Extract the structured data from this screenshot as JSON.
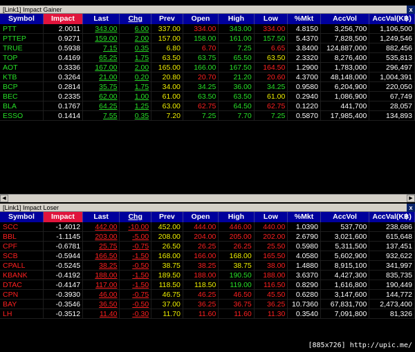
{
  "gainer": {
    "title": "[Link1] Impact Gainer",
    "close": "x",
    "headers": [
      "Symbol",
      "Impact",
      "Last",
      "Chg",
      "Prev",
      "Open",
      "High",
      "Low",
      "%Mkt",
      "AccVol",
      "AccVal(K฿)"
    ],
    "rows": [
      {
        "symbol": "PTT",
        "impact": "2.0011",
        "last": "343.00",
        "chg": "6.00",
        "prev": "337.00",
        "open": "334.00",
        "high": "343.00",
        "low": "334.00",
        "mkt": "4.8150",
        "vol": "3,256,700",
        "val": "1,106,500",
        "oc": "red",
        "hc": "green",
        "lc": "red"
      },
      {
        "symbol": "PTTEP",
        "impact": "0.9271",
        "last": "159.00",
        "chg": "2.00",
        "prev": "157.00",
        "open": "158.00",
        "high": "161.00",
        "low": "157.50",
        "mkt": "5.4370",
        "vol": "7,828,500",
        "val": "1,249,546",
        "oc": "green",
        "hc": "green",
        "lc": "green"
      },
      {
        "symbol": "TRUE",
        "impact": "0.5938",
        "last": "7.15",
        "chg": "0.35",
        "prev": "6.80",
        "open": "6.70",
        "high": "7.25",
        "low": "6.65",
        "mkt": "3.8400",
        "vol": "124,887,000",
        "val": "882,456",
        "oc": "red",
        "hc": "green",
        "lc": "red"
      },
      {
        "symbol": "TOP",
        "impact": "0.4169",
        "last": "65.25",
        "chg": "1.75",
        "prev": "63.50",
        "open": "63.75",
        "high": "65.50",
        "low": "63.50",
        "mkt": "2.3320",
        "vol": "8,276,400",
        "val": "535,813",
        "oc": "green",
        "hc": "green",
        "lc": "yellow"
      },
      {
        "symbol": "AOT",
        "impact": "0.3336",
        "last": "167.00",
        "chg": "2.00",
        "prev": "165.00",
        "open": "166.00",
        "high": "167.50",
        "low": "164.50",
        "mkt": "1.2900",
        "vol": "1,783,000",
        "val": "296,497",
        "oc": "green",
        "hc": "green",
        "lc": "red"
      },
      {
        "symbol": "KTB",
        "impact": "0.3264",
        "last": "21.00",
        "chg": "0.20",
        "prev": "20.80",
        "open": "20.70",
        "high": "21.20",
        "low": "20.60",
        "mkt": "4.3700",
        "vol": "48,148,000",
        "val": "1,004,391",
        "oc": "red",
        "hc": "green",
        "lc": "red"
      },
      {
        "symbol": "BCP",
        "impact": "0.2814",
        "last": "35.75",
        "chg": "1.75",
        "prev": "34.00",
        "open": "34.25",
        "high": "36.00",
        "low": "34.25",
        "mkt": "0.9580",
        "vol": "6,204,900",
        "val": "220,050",
        "oc": "green",
        "hc": "green",
        "lc": "green"
      },
      {
        "symbol": "BEC",
        "impact": "0.2335",
        "last": "62.00",
        "chg": "1.00",
        "prev": "61.00",
        "open": "63.50",
        "high": "63.50",
        "low": "61.00",
        "mkt": "0.2940",
        "vol": "1,086,900",
        "val": "67,749",
        "oc": "green",
        "hc": "green",
        "lc": "yellow"
      },
      {
        "symbol": "BLA",
        "impact": "0.1767",
        "last": "64.25",
        "chg": "1.25",
        "prev": "63.00",
        "open": "62.75",
        "high": "64.50",
        "low": "62.75",
        "mkt": "0.1220",
        "vol": "441,700",
        "val": "28,057",
        "oc": "red",
        "hc": "green",
        "lc": "red"
      },
      {
        "symbol": "ESSO",
        "impact": "0.1414",
        "last": "7.55",
        "chg": "0.35",
        "prev": "7.20",
        "open": "7.25",
        "high": "7.70",
        "low": "7.25",
        "mkt": "0.5870",
        "vol": "17,985,400",
        "val": "134,893",
        "oc": "green",
        "hc": "green",
        "lc": "green"
      }
    ]
  },
  "loser": {
    "title": "[Link1] Impact Loser",
    "close": "x",
    "headers": [
      "Symbol",
      "Impact",
      "Last",
      "Chg",
      "Prev",
      "Open",
      "High",
      "Low",
      "%Mkt",
      "AccVol",
      "AccVal(K฿)"
    ],
    "rows": [
      {
        "symbol": "SCC",
        "impact": "-1.4012",
        "last": "442.00",
        "chg": "-10.00",
        "prev": "452.00",
        "open": "444.00",
        "high": "446.00",
        "low": "440.00",
        "mkt": "1.0390",
        "vol": "537,700",
        "val": "238,686",
        "oc": "red",
        "hc": "red",
        "lc": "red"
      },
      {
        "symbol": "BBL",
        "impact": "-1.1145",
        "last": "203.00",
        "chg": "-5.00",
        "prev": "208.00",
        "open": "204.00",
        "high": "205.00",
        "low": "202.00",
        "mkt": "2.6790",
        "vol": "3,021,600",
        "val": "615,648",
        "oc": "red",
        "hc": "red",
        "lc": "red"
      },
      {
        "symbol": "CPF",
        "impact": "-0.6781",
        "last": "25.75",
        "chg": "-0.75",
        "prev": "26.50",
        "open": "26.25",
        "high": "26.25",
        "low": "25.50",
        "mkt": "0.5980",
        "vol": "5,311,500",
        "val": "137,451",
        "oc": "red",
        "hc": "red",
        "lc": "red"
      },
      {
        "symbol": "SCB",
        "impact": "-0.5944",
        "last": "166.50",
        "chg": "-1.50",
        "prev": "168.00",
        "open": "166.00",
        "high": "168.00",
        "low": "165.50",
        "mkt": "4.0580",
        "vol": "5,602,900",
        "val": "932,622",
        "oc": "red",
        "hc": "yellow",
        "lc": "red"
      },
      {
        "symbol": "CPALL",
        "impact": "-0.5245",
        "last": "38.25",
        "chg": "-0.50",
        "prev": "38.75",
        "open": "38.25",
        "high": "38.75",
        "low": "38.00",
        "mkt": "1.4880",
        "vol": "8,915,100",
        "val": "341,997",
        "oc": "red",
        "hc": "yellow",
        "lc": "red"
      },
      {
        "symbol": "KBANK",
        "impact": "-0.4192",
        "last": "188.00",
        "chg": "-1.50",
        "prev": "189.50",
        "open": "188.00",
        "high": "190.50",
        "low": "188.00",
        "mkt": "3.6370",
        "vol": "4,427,300",
        "val": "835,735",
        "oc": "red",
        "hc": "green",
        "lc": "red"
      },
      {
        "symbol": "DTAC",
        "impact": "-0.4147",
        "last": "117.00",
        "chg": "-1.50",
        "prev": "118.50",
        "open": "118.50",
        "high": "119.00",
        "low": "116.50",
        "mkt": "0.8290",
        "vol": "1,616,800",
        "val": "190,449",
        "oc": "yellow",
        "hc": "green",
        "lc": "red"
      },
      {
        "symbol": "CPN",
        "impact": "-0.3930",
        "last": "46.00",
        "chg": "-0.75",
        "prev": "46.75",
        "open": "46.25",
        "high": "46.50",
        "low": "45.50",
        "mkt": "0.6280",
        "vol": "3,147,600",
        "val": "144,772",
        "oc": "red",
        "hc": "red",
        "lc": "red"
      },
      {
        "symbol": "BAY",
        "impact": "-0.3546",
        "last": "36.50",
        "chg": "-0.50",
        "prev": "37.00",
        "open": "36.25",
        "high": "36.75",
        "low": "36.25",
        "mkt": "10.7360",
        "vol": "67,831,700",
        "val": "2,473,400",
        "oc": "red",
        "hc": "red",
        "lc": "red"
      },
      {
        "symbol": "LH",
        "impact": "-0.3512",
        "last": "11.40",
        "chg": "-0.30",
        "prev": "11.70",
        "open": "11.60",
        "high": "11.60",
        "low": "11.30",
        "mkt": "0.3540",
        "vol": "7,091,800",
        "val": "81,326",
        "oc": "red",
        "hc": "red",
        "lc": "red"
      }
    ]
  },
  "colors": {
    "gain": "#28e028",
    "loss": "#ff2020",
    "unchanged": "#f0f000",
    "header_bg": "#00009c",
    "sorted_header": "#e0143c"
  },
  "watermark": "[885x726] http://upic.me/"
}
